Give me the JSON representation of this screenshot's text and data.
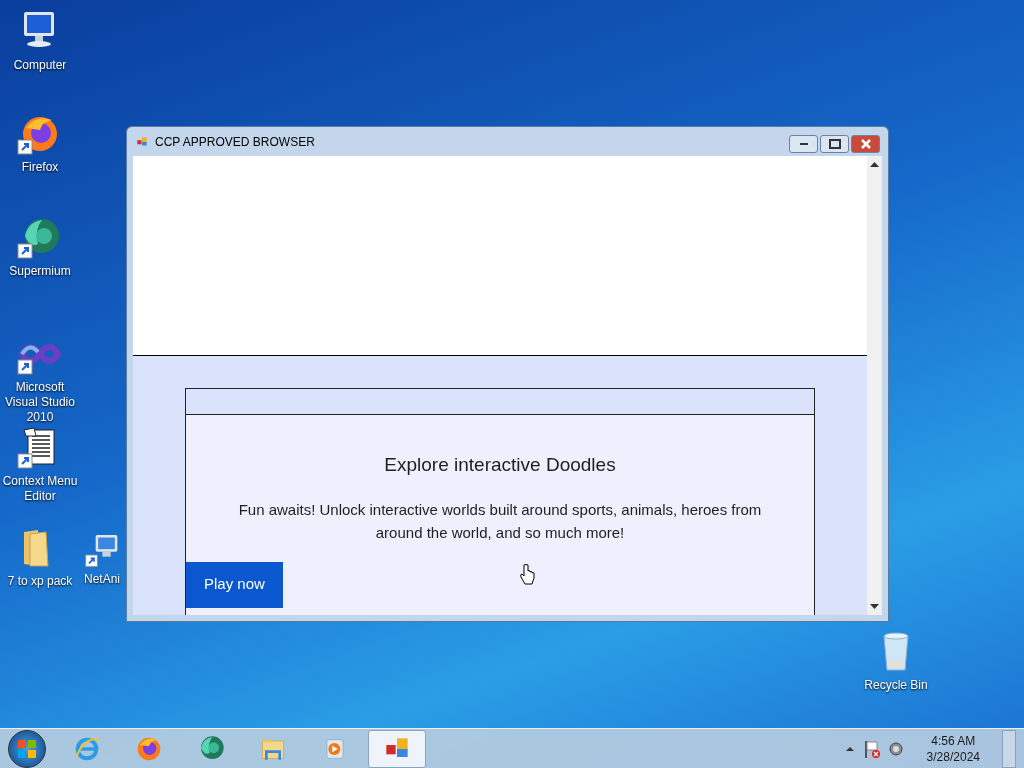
{
  "desktop_icons": [
    {
      "label": "Computer",
      "kind": "computer",
      "shortcut": false
    },
    {
      "label": "Firefox",
      "kind": "firefox",
      "shortcut": true
    },
    {
      "label": "Supermium",
      "kind": "supermium",
      "shortcut": true
    },
    {
      "label": "Microsoft Visual Studio 2010",
      "kind": "visualstudio",
      "shortcut": true
    },
    {
      "label": "Context Menu Editor",
      "kind": "document",
      "shortcut": true
    },
    {
      "label": "7 to xp pack",
      "kind": "folder",
      "shortcut": false
    },
    {
      "label": "NetAni",
      "kind": "network",
      "shortcut": true
    },
    {
      "label": "Recycle Bin",
      "kind": "recycle",
      "shortcut": false
    }
  ],
  "window": {
    "title": "CCP APPROVED BROWSER"
  },
  "page": {
    "heading": "Explore interactive Doodles",
    "text": "Fun awaits! Unlock interactive worlds built around sports, animals, heroes from around the world, and so much more!",
    "button": "Play now"
  },
  "taskbar": {
    "buttons": [
      {
        "kind": "ie",
        "selected": false
      },
      {
        "kind": "firefox",
        "selected": false
      },
      {
        "kind": "supermium",
        "selected": false
      },
      {
        "kind": "explorer",
        "selected": false
      },
      {
        "kind": "mediaplayer",
        "selected": false
      },
      {
        "kind": "app",
        "selected": true
      }
    ],
    "time": "4:56 AM",
    "date": "3/28/2024"
  }
}
